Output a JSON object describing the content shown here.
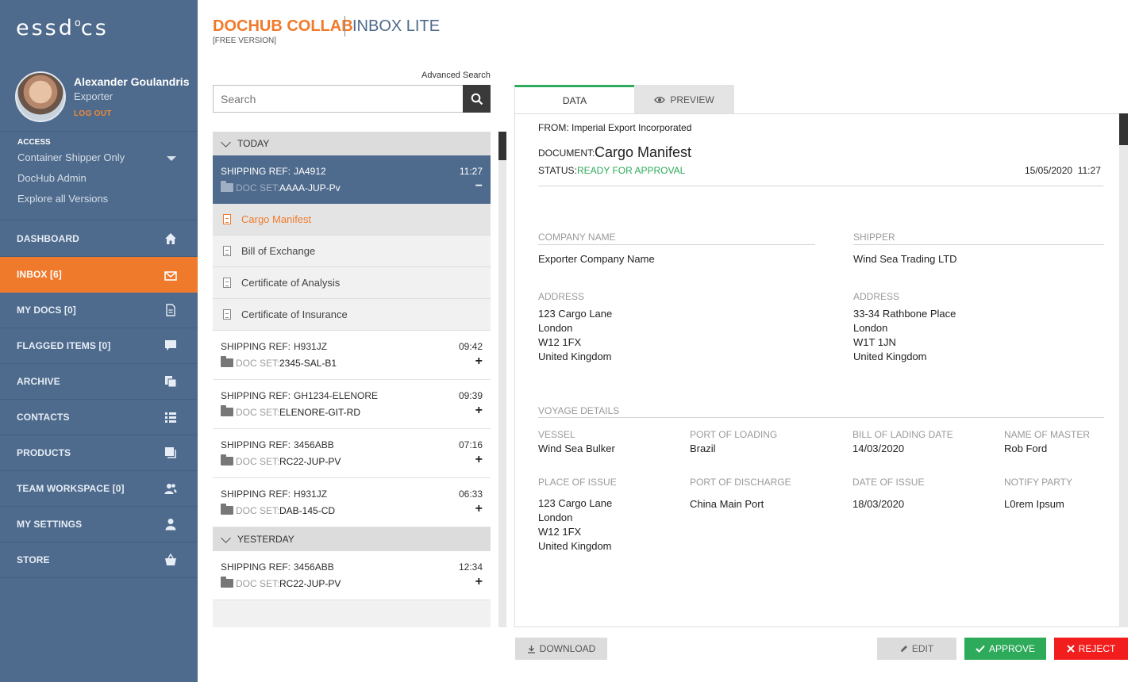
{
  "brand": {
    "logo_prefix": "essd",
    "logo_o": "o",
    "logo_suffix": "cs"
  },
  "user": {
    "name": "Alexander Goulandris",
    "role": "Exporter",
    "logout": "LOG OUT"
  },
  "access": {
    "label": "ACCESS",
    "selected": "Container Shipper Only",
    "items": [
      "DocHub Admin",
      "Explore all Versions"
    ]
  },
  "nav": [
    {
      "label": "DASHBOARD",
      "icon": "home-icon"
    },
    {
      "label": "INBOX [6]",
      "icon": "envelope-icon",
      "active": true
    },
    {
      "label": "MY DOCS  [0]",
      "icon": "document-icon"
    },
    {
      "label": "FLAGGED ITEMS [0]",
      "icon": "flag-icon"
    },
    {
      "label": "ARCHIVE",
      "icon": "archive-icon"
    },
    {
      "label": "CONTACTS",
      "icon": "list-icon"
    },
    {
      "label": "PRODUCTS",
      "icon": "products-icon"
    },
    {
      "label": "TEAM WORKSPACE  [0]",
      "icon": "team-icon"
    },
    {
      "label": "MY SETTINGS",
      "icon": "user-icon"
    },
    {
      "label": "STORE",
      "icon": "basket-icon"
    }
  ],
  "header": {
    "title": "DOCHUB COLLAB",
    "subtitle": "INBOX LITE",
    "version": "[FREE VERSION]"
  },
  "search": {
    "advanced": "Advanced Search",
    "placeholder": "Search"
  },
  "inbox": {
    "today_label": "TODAY",
    "yesterday_label": "YESTERDAY",
    "ref_label": "SHIPPING REF:",
    "docset_label": "DOC SET:",
    "selected": {
      "ref": "JA4912",
      "time": "11:27",
      "docset": "AAAA-JUP-Pv",
      "toggle": "−"
    },
    "documents": [
      "Cargo Manifest",
      "Bill of Exchange",
      "Certificate of Analysis",
      "Certificate of Insurance"
    ],
    "today": [
      {
        "ref": "H931JZ",
        "time": "09:42",
        "docset": "2345-SAL-B1",
        "toggle": "+"
      },
      {
        "ref": "GH1234-ELENORE",
        "time": "09:39",
        "docset": "ELENORE-GIT-RD",
        "toggle": "+"
      },
      {
        "ref": "3456ABB",
        "time": "07:16",
        "docset": "RC22-JUP-PV",
        "toggle": "+"
      },
      {
        "ref": "H931JZ",
        "time": "06:33",
        "docset": "DAB-145-CD",
        "toggle": "+"
      }
    ],
    "yesterday": [
      {
        "ref": "3456ABB",
        "time": "12:34",
        "docset": "RC22-JUP-PV",
        "toggle": "+"
      }
    ]
  },
  "tabs": {
    "data": "DATA",
    "preview": "PREVIEW"
  },
  "detail": {
    "from": "FROM: Imperial Export Incorporated",
    "document_label": "DOCUMENT:",
    "document": "Cargo Manifest",
    "status_label": "STATUS:",
    "status": "READY FOR APPROVAL",
    "status_color": "#2dab5a",
    "datetime": "15/05/2020  11:27",
    "company_name_label": "COMPANY NAME",
    "company_name": "Exporter Company Name",
    "shipper_label": "SHIPPER",
    "shipper": "Wind Sea Trading LTD",
    "address_label": "ADDRESS",
    "company_address": [
      "123 Cargo Lane",
      "London",
      "W12 1FX",
      "United Kingdom"
    ],
    "shipper_address": [
      "33-34 Rathbone Place",
      "London",
      "W1T 1JN",
      "United Kingdom"
    ],
    "voyage_label": "VOYAGE DETAILS",
    "vessel_label": "VESSEL",
    "vessel": "Wind Sea Bulker",
    "port_loading_label": "PORT OF LOADING",
    "port_loading": "Brazil",
    "bol_date_label": "BILL OF LADING DATE",
    "bol_date": "14/03/2020",
    "master_label": "NAME OF MASTER",
    "master": "Rob Ford",
    "place_issue_label": "PLACE OF ISSUE",
    "place_issue": [
      "123 Cargo Lane",
      "London",
      "W12 1FX",
      "United Kingdom"
    ],
    "port_discharge_label": "PORT OF DISCHARGE",
    "port_discharge": "China Main Port",
    "date_issue_label": "DATE OF ISSUE",
    "date_issue": "18/03/2020",
    "notify_label": "NOTIFY PARTY",
    "notify": "L0rem Ipsum"
  },
  "actions": {
    "download": "DOWNLOAD",
    "edit": "EDIT",
    "approve": "APPROVE",
    "reject": "REJECT"
  },
  "colors": {
    "sidebar": "#4e6a8c",
    "accent": "#f07a2b",
    "approve": "#2dab5a",
    "reject": "#f21e1e"
  }
}
